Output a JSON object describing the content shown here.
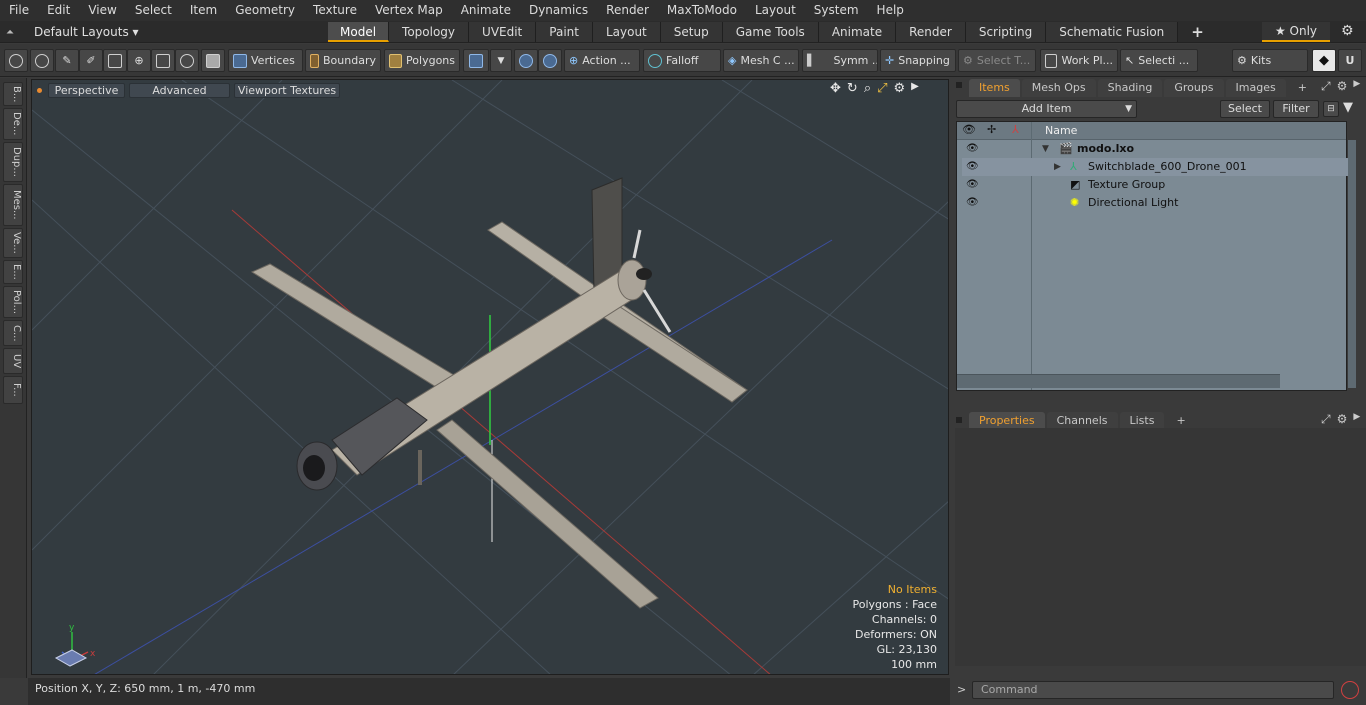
{
  "menu": [
    "File",
    "Edit",
    "View",
    "Select",
    "Item",
    "Geometry",
    "Texture",
    "Vertex Map",
    "Animate",
    "Dynamics",
    "Render",
    "MaxToModo",
    "Layout",
    "System",
    "Help"
  ],
  "layout_selector": "Default Layouts ▾",
  "mode_tabs": [
    "Model",
    "Topology",
    "UVEdit",
    "Paint",
    "Layout",
    "Setup",
    "Game Tools",
    "Animate",
    "Render",
    "Scripting",
    "Schematic Fusion"
  ],
  "active_mode_tab": "Model",
  "only_label": "★ Only",
  "toolbar": {
    "vertices": "Vertices",
    "boundary": "Boundary",
    "polygons": "Polygons",
    "action": "Action ...",
    "falloff": "Falloff",
    "mesh_c": "Mesh C ...",
    "symm": "Symm ...",
    "snapping": "Snapping",
    "select_t": "Select T...",
    "work_pl": "Work Pl...",
    "selecti": "Selecti ...",
    "kits": "Kits"
  },
  "left_tabs": [
    "B...",
    "De...",
    "Dup...",
    "Mes...",
    "Ve...",
    "E...",
    "Pol...",
    "C...",
    "UV",
    "F..."
  ],
  "viewport": {
    "perspective": "Perspective",
    "advanced": "Advanced",
    "viewport_textures": "Viewport Textures",
    "hud": {
      "no_items": "No Items",
      "polygons": "Polygons : Face",
      "channels": "Channels: 0",
      "deformers": "Deformers: ON",
      "gl": "GL: 23,130",
      "scale": "100 mm"
    }
  },
  "status": {
    "position": "Position X, Y, Z:   650 mm, 1 m, -470 mm"
  },
  "items_panel": {
    "tabs": [
      "Items",
      "Mesh Ops",
      "Shading",
      "Groups",
      "Images"
    ],
    "active_tab": "Items",
    "add_item": "Add Item",
    "select": "Select",
    "filter": "Filter",
    "name_header": "Name",
    "tree": [
      {
        "label": "modo.lxo"
      },
      {
        "label": "Switchblade_600_Drone_001"
      },
      {
        "label": "Texture Group"
      },
      {
        "label": "Directional Light"
      }
    ]
  },
  "properties_panel": {
    "tabs": [
      "Properties",
      "Channels",
      "Lists"
    ],
    "active_tab": "Properties"
  },
  "command": {
    "placeholder": "Command"
  },
  "colors": {
    "accent": "#e8a000",
    "viewport_bg": "#333b40",
    "items_bg": "#7c8a94"
  }
}
